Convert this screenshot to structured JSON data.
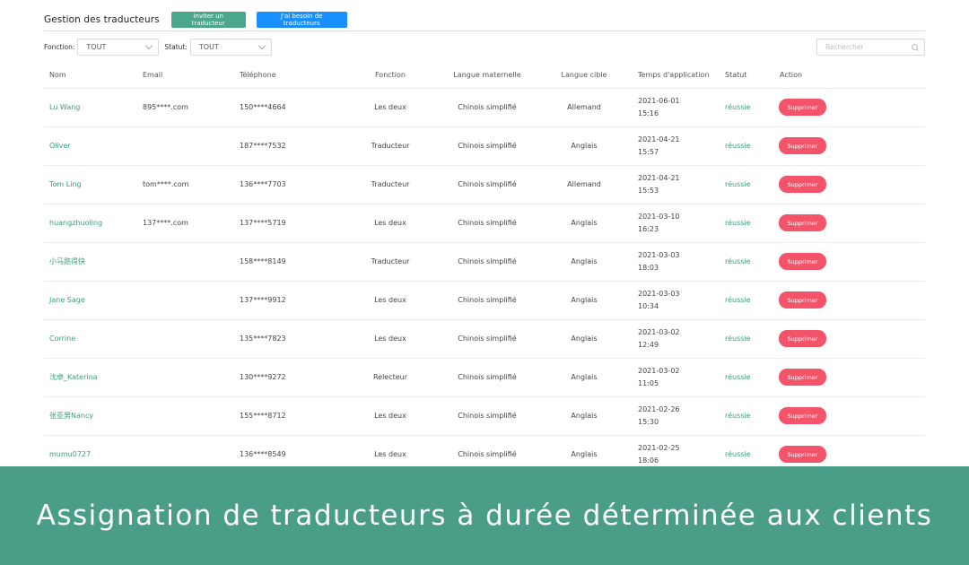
{
  "header": {
    "title": "Gestion des traducteurs",
    "invite_label": "inviter un traducteur",
    "need_label": "J'ai besoin de traducteurs"
  },
  "filters": {
    "function_label": "Fonction:",
    "function_value": "TOUT",
    "status_label": "Statut:",
    "status_value": "TOUT"
  },
  "search": {
    "placeholder": "Rechercher"
  },
  "table": {
    "columns": [
      "Nom",
      "Email",
      "Téléphone",
      "Fonction",
      "Langue maternelle",
      "Langue cible",
      "Temps d'application",
      "Statut",
      "Action"
    ],
    "delete_label": "Supprimer",
    "rows": [
      {
        "name": "Lu Wang",
        "email": "895****.com",
        "phone": "150****4664",
        "function": "Les deux",
        "native": "Chinois simplifié",
        "target": "Allemand",
        "date": "2021-06-01",
        "time": "15:16",
        "status": "réussie"
      },
      {
        "name": "Oliver",
        "email": "",
        "phone": "187****7532",
        "function": "Traducteur",
        "native": "Chinois simplifié",
        "target": "Anglais",
        "date": "2021-04-21",
        "time": "15:57",
        "status": "réussie"
      },
      {
        "name": "Tom Ling",
        "email": "tom****.com",
        "phone": "136****7703",
        "function": "Traducteur",
        "native": "Chinois simplifié",
        "target": "Allemand",
        "date": "2021-04-21",
        "time": "15:53",
        "status": "réussie"
      },
      {
        "name": "huangzhuoling",
        "email": "137****.com",
        "phone": "137****5719",
        "function": "Les deux",
        "native": "Chinois simplifié",
        "target": "Anglais",
        "date": "2021-03-10",
        "time": "16:23",
        "status": "réussie"
      },
      {
        "name": "小马跑得快",
        "email": "",
        "phone": "158****8149",
        "function": "Traducteur",
        "native": "Chinois simplifié",
        "target": "Anglais",
        "date": "2021-03-03",
        "time": "18:03",
        "status": "réussie"
      },
      {
        "name": "Jane Sage",
        "email": "",
        "phone": "137****9912",
        "function": "Les deux",
        "native": "Chinois simplifié",
        "target": "Anglais",
        "date": "2021-03-03",
        "time": "10:34",
        "status": "réussie"
      },
      {
        "name": "Corrine",
        "email": "",
        "phone": "135****7823",
        "function": "Les deux",
        "native": "Chinois simplifié",
        "target": "Anglais",
        "date": "2021-03-02",
        "time": "12:49",
        "status": "réussie"
      },
      {
        "name": "沈卓_Katerina",
        "email": "",
        "phone": "130****9272",
        "function": "Relecteur",
        "native": "Chinois simplifié",
        "target": "Anglais",
        "date": "2021-03-02",
        "time": "11:05",
        "status": "réussie"
      },
      {
        "name": "张亚男Nancy",
        "email": "",
        "phone": "155****8712",
        "function": "Les deux",
        "native": "Chinois simplifié",
        "target": "Anglais",
        "date": "2021-02-26",
        "time": "15:30",
        "status": "réussie"
      },
      {
        "name": "mumu0727",
        "email": "",
        "phone": "136****8549",
        "function": "Les deux",
        "native": "Chinois simplifié",
        "target": "Anglais",
        "date": "2021-02-25",
        "time": "18:06",
        "status": "réussie"
      }
    ]
  },
  "banner": {
    "text": "Assignation de traducteurs à durée déterminée aux clients"
  },
  "colors": {
    "accent": "#4a9e88",
    "link_green": "#3a9c7f",
    "primary_blue": "#1890ff",
    "delete_red": "#f4546a"
  }
}
